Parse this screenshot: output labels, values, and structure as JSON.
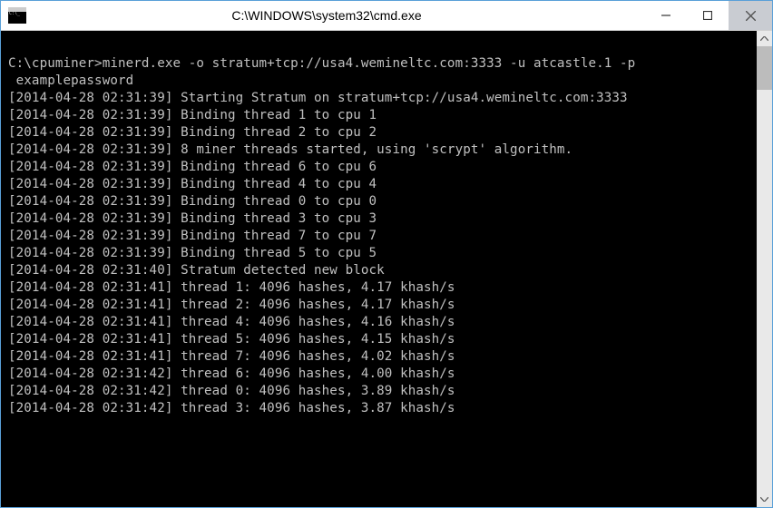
{
  "window": {
    "title": "C:\\WINDOWS\\system32\\cmd.exe"
  },
  "terminal": {
    "prompt_path": "C:\\cpuminer>",
    "command": "minerd.exe -o stratum+tcp://usa4.wemineltc.com:3333 -u atcastle.1 -p",
    "command_cont": " examplepassword",
    "lines": [
      "[2014-04-28 02:31:39] Starting Stratum on stratum+tcp://usa4.wemineltc.com:3333",
      "[2014-04-28 02:31:39] Binding thread 1 to cpu 1",
      "[2014-04-28 02:31:39] Binding thread 2 to cpu 2",
      "[2014-04-28 02:31:39] 8 miner threads started, using 'scrypt' algorithm.",
      "[2014-04-28 02:31:39] Binding thread 6 to cpu 6",
      "[2014-04-28 02:31:39] Binding thread 4 to cpu 4",
      "[2014-04-28 02:31:39] Binding thread 0 to cpu 0",
      "[2014-04-28 02:31:39] Binding thread 3 to cpu 3",
      "[2014-04-28 02:31:39] Binding thread 7 to cpu 7",
      "[2014-04-28 02:31:39] Binding thread 5 to cpu 5",
      "[2014-04-28 02:31:40] Stratum detected new block",
      "[2014-04-28 02:31:41] thread 1: 4096 hashes, 4.17 khash/s",
      "[2014-04-28 02:31:41] thread 2: 4096 hashes, 4.17 khash/s",
      "[2014-04-28 02:31:41] thread 4: 4096 hashes, 4.16 khash/s",
      "[2014-04-28 02:31:41] thread 5: 4096 hashes, 4.15 khash/s",
      "[2014-04-28 02:31:41] thread 7: 4096 hashes, 4.02 khash/s",
      "[2014-04-28 02:31:42] thread 6: 4096 hashes, 4.00 khash/s",
      "[2014-04-28 02:31:42] thread 0: 4096 hashes, 3.89 khash/s",
      "[2014-04-28 02:31:42] thread 3: 4096 hashes, 3.87 khash/s"
    ]
  }
}
